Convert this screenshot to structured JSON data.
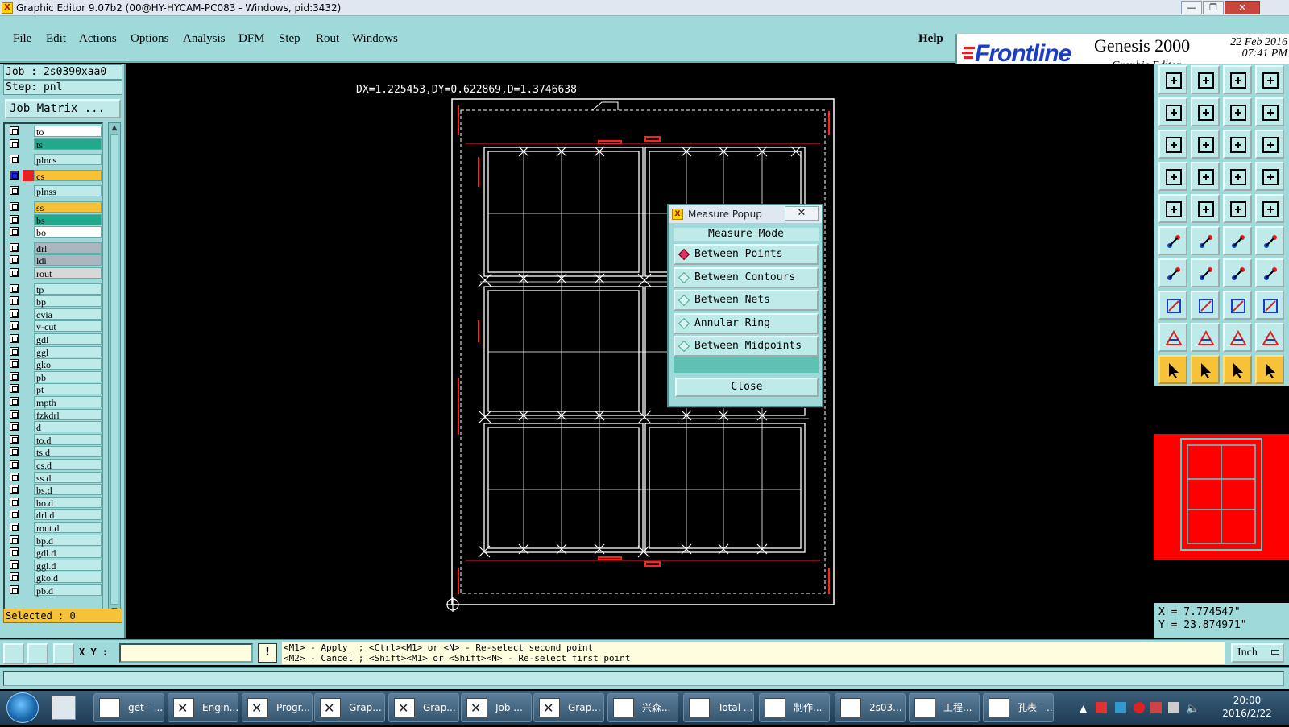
{
  "window": {
    "title": "Graphic Editor 9.07b2 (00@HY-HYCAM-PC083 - Windows, pid:3432)",
    "buttons": [
      "minimize",
      "restore",
      "close"
    ]
  },
  "menu": [
    "File",
    "Edit",
    "Actions",
    "Options",
    "Analysis",
    "DFM",
    "Step",
    "Rout",
    "Windows"
  ],
  "help": "Help",
  "brand": {
    "logo": "Frontline",
    "product": "Genesis 2000",
    "subtitle": "Graphic Editor",
    "date": "22 Feb 2016",
    "time": "07:41 PM"
  },
  "job": {
    "job_line": "Job : 2s0390xaa0",
    "step_line": "Step: pnl",
    "matrix_button": "Job Matrix ..."
  },
  "layers": [
    {
      "name": "to",
      "color": "#ffffff"
    },
    {
      "name": "ts",
      "color": "#21a98c"
    },
    {
      "name": "plncs",
      "color": "#bfeaea"
    },
    {
      "name": "cs",
      "color": "#f5c23a",
      "active": true
    },
    {
      "name": "plnss",
      "color": "#bfeaea"
    },
    {
      "name": "ss",
      "color": "#f5c23a"
    },
    {
      "name": "bs",
      "color": "#21a98c"
    },
    {
      "name": "bo",
      "color": "#ffffff"
    },
    {
      "name": "drl",
      "color": "#a9b8c0"
    },
    {
      "name": "ldi",
      "color": "#a9b8c0"
    },
    {
      "name": "rout",
      "color": "#d8d8d8"
    },
    {
      "name": "tp",
      "color": "#bfeaea"
    },
    {
      "name": "bp",
      "color": "#bfeaea"
    },
    {
      "name": "cvia",
      "color": "#bfeaea"
    },
    {
      "name": "v-cut",
      "color": "#bfeaea"
    },
    {
      "name": "gdl",
      "color": "#bfeaea"
    },
    {
      "name": "ggl",
      "color": "#bfeaea"
    },
    {
      "name": "gko",
      "color": "#bfeaea"
    },
    {
      "name": "pb",
      "color": "#bfeaea"
    },
    {
      "name": "pt",
      "color": "#bfeaea"
    },
    {
      "name": "mpth",
      "color": "#bfeaea"
    },
    {
      "name": "fzkdrl",
      "color": "#bfeaea"
    },
    {
      "name": "d",
      "color": "#bfeaea"
    },
    {
      "name": "to.d",
      "color": "#bfeaea"
    },
    {
      "name": "ts.d",
      "color": "#bfeaea"
    },
    {
      "name": "cs.d",
      "color": "#bfeaea"
    },
    {
      "name": "ss.d",
      "color": "#bfeaea"
    },
    {
      "name": "bs.d",
      "color": "#bfeaea"
    },
    {
      "name": "bo.d",
      "color": "#bfeaea"
    },
    {
      "name": "drl.d",
      "color": "#bfeaea"
    },
    {
      "name": "rout.d",
      "color": "#bfeaea"
    },
    {
      "name": "bp.d",
      "color": "#bfeaea"
    },
    {
      "name": "gdl.d",
      "color": "#bfeaea"
    },
    {
      "name": "ggl.d",
      "color": "#bfeaea"
    },
    {
      "name": "gko.d",
      "color": "#bfeaea"
    },
    {
      "name": "pb.d",
      "color": "#bfeaea"
    }
  ],
  "selected": "Selected : 0",
  "measure_readout": "DX=1.225453,DY=0.622869,D=1.3746638",
  "popup": {
    "title": "Measure Popup",
    "mode_label": "Measure Mode",
    "options": [
      {
        "label": "Between Points",
        "selected": true
      },
      {
        "label": "Between Contours",
        "selected": false
      },
      {
        "label": "Between Nets",
        "selected": false
      },
      {
        "label": "Annular Ring",
        "selected": false
      },
      {
        "label": "Between Midpoints",
        "selected": false
      }
    ],
    "close_label": "Close"
  },
  "coords": {
    "x": "X = 7.774547\"",
    "y": "Y = 23.874971\""
  },
  "command": {
    "xy_label": "X Y :",
    "xy_value": "",
    "excl": "!",
    "hint1": "<M1> - Apply  ; <Ctrl><M1> or <N> - Re-select second point",
    "hint2": "<M2> - Cancel ; <Shift><M1> or <Shift><N> - Re-select first point",
    "units": "Inch"
  },
  "taskbar": {
    "items": [
      "get - ...",
      "Engin...",
      "Progr...",
      "Grap...",
      "Grap...",
      "Job ...",
      "Grap...",
      "兴森...",
      "Total ...",
      "制作...",
      "2s03...",
      "工程...",
      "孔表 - ..."
    ],
    "time": "20:00",
    "date": "2016/2/22"
  }
}
